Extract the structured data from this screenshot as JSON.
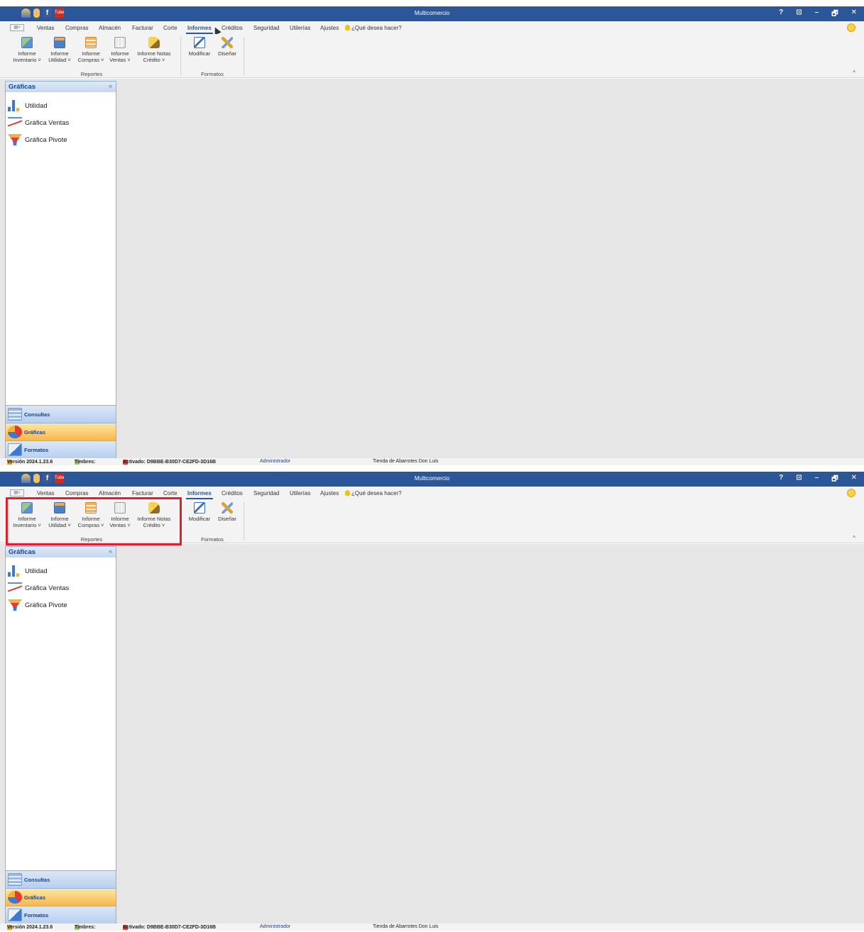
{
  "app": {
    "title": "Multicomercio"
  },
  "window_controls": {
    "help": "?",
    "restore_ribbon": "⊡",
    "minimize": "–",
    "maximize": "🗗",
    "close": "✕"
  },
  "tabs": [
    {
      "label": "Ventas"
    },
    {
      "label": "Compras"
    },
    {
      "label": "Almacén"
    },
    {
      "label": "Facturar"
    },
    {
      "label": "Corte"
    },
    {
      "label": "Informes"
    },
    {
      "label": "Créditos"
    },
    {
      "label": "Seguridad"
    },
    {
      "label": "Utilerías"
    },
    {
      "label": "Ajustes"
    }
  ],
  "ask": {
    "label": "¿Qué desea hacer?"
  },
  "ribbon": {
    "reportes": {
      "group_label": "Reportes",
      "buttons": [
        {
          "line1": "Informe",
          "line2": "Inventario ˅"
        },
        {
          "line1": "Informe",
          "line2": "Utilidad ˅"
        },
        {
          "line1": "Informe",
          "line2": "Compras ˅"
        },
        {
          "line1": "Informe",
          "line2": "Ventas ˅"
        },
        {
          "line1": "Informe Notas",
          "line2": "Crédito ˅"
        }
      ]
    },
    "formatos": {
      "group_label": "Formatos",
      "buttons": [
        {
          "line1": "Modificar"
        },
        {
          "line1": "Diseñar"
        }
      ]
    },
    "collapse": "^"
  },
  "sidebar": {
    "header": "Gráficas",
    "collapse": "«",
    "items": [
      {
        "label": "Utilidad"
      },
      {
        "label": "Gráfica Ventas"
      },
      {
        "label": "Gráfica Pivote"
      }
    ],
    "nav": [
      {
        "label": "Consultas"
      },
      {
        "label": "Gráficas"
      },
      {
        "label": "Formatos"
      }
    ]
  },
  "status": {
    "version": "Versión 2024.1.23.6",
    "timbres": "Timbres:",
    "activado": "Activado: D9BBE-B30D7-CE2FD-3D16B",
    "user": "Administrador",
    "store": "Tienda de Abarrotes Don Luis"
  },
  "colors": {
    "titlebar": "#2b579a",
    "highlight": "#e0202a",
    "active_nav": "#f8b84a"
  }
}
